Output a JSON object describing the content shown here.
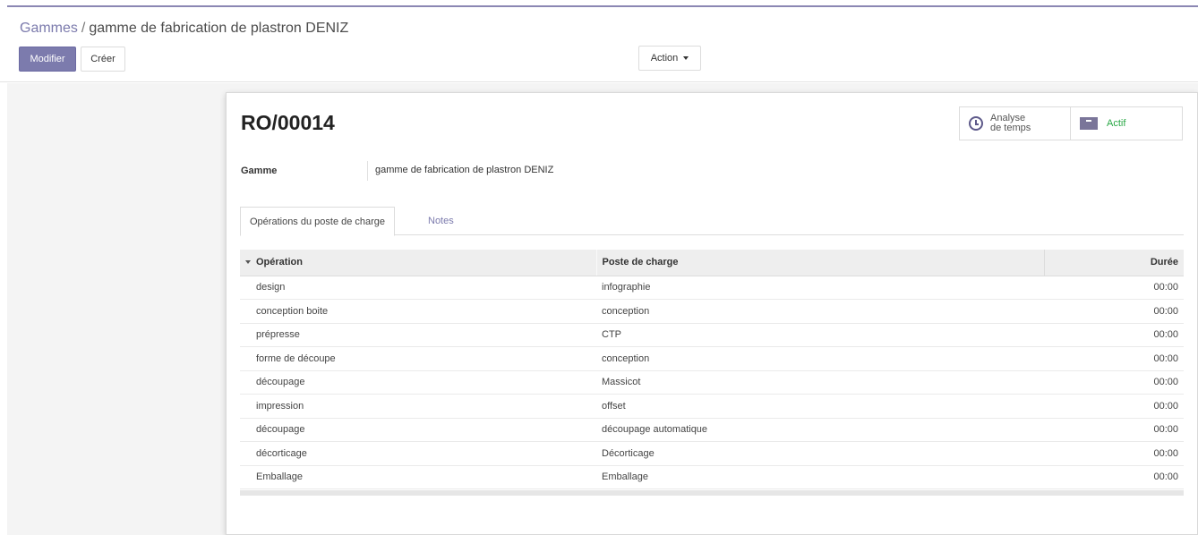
{
  "breadcrumb": {
    "parent": "Gammes",
    "separator": "/",
    "current": "gamme de fabrication de plastron DENIZ"
  },
  "toolbar": {
    "edit_label": "Modifier",
    "create_label": "Créer",
    "action_label": "Action"
  },
  "colors": {
    "primary": "#7c7bad",
    "active": "#28a745"
  },
  "record": {
    "reference": "RO/00014",
    "smart_buttons": {
      "time_analysis_line1": "Analyse",
      "time_analysis_line2": "de temps",
      "time_icon": "clock-icon",
      "active_label": "Actif",
      "active_icon": "archive-icon"
    },
    "field": {
      "label": "Gamme",
      "value": "gamme de fabrication de plastron DENIZ"
    }
  },
  "tabs": [
    {
      "label": "Opérations du poste de charge",
      "active": true
    },
    {
      "label": "Notes",
      "active": false
    }
  ],
  "table": {
    "headers": {
      "operation": "Opération",
      "workcenter": "Poste de charge",
      "duration": "Durée"
    },
    "rows": [
      {
        "operation": "design",
        "workcenter": "infographie",
        "duration": "00:00"
      },
      {
        "operation": "conception boite",
        "workcenter": "conception",
        "duration": "00:00"
      },
      {
        "operation": "prépresse",
        "workcenter": "CTP",
        "duration": "00:00"
      },
      {
        "operation": "forme de découpe",
        "workcenter": "conception",
        "duration": "00:00"
      },
      {
        "operation": "découpage",
        "workcenter": "Massicot",
        "duration": "00:00"
      },
      {
        "operation": "impression",
        "workcenter": "offset",
        "duration": "00:00"
      },
      {
        "operation": "découpage",
        "workcenter": "découpage automatique",
        "duration": "00:00"
      },
      {
        "operation": "décorticage",
        "workcenter": "Décorticage",
        "duration": "00:00"
      },
      {
        "operation": "Emballage",
        "workcenter": "Emballage",
        "duration": "00:00"
      }
    ]
  }
}
